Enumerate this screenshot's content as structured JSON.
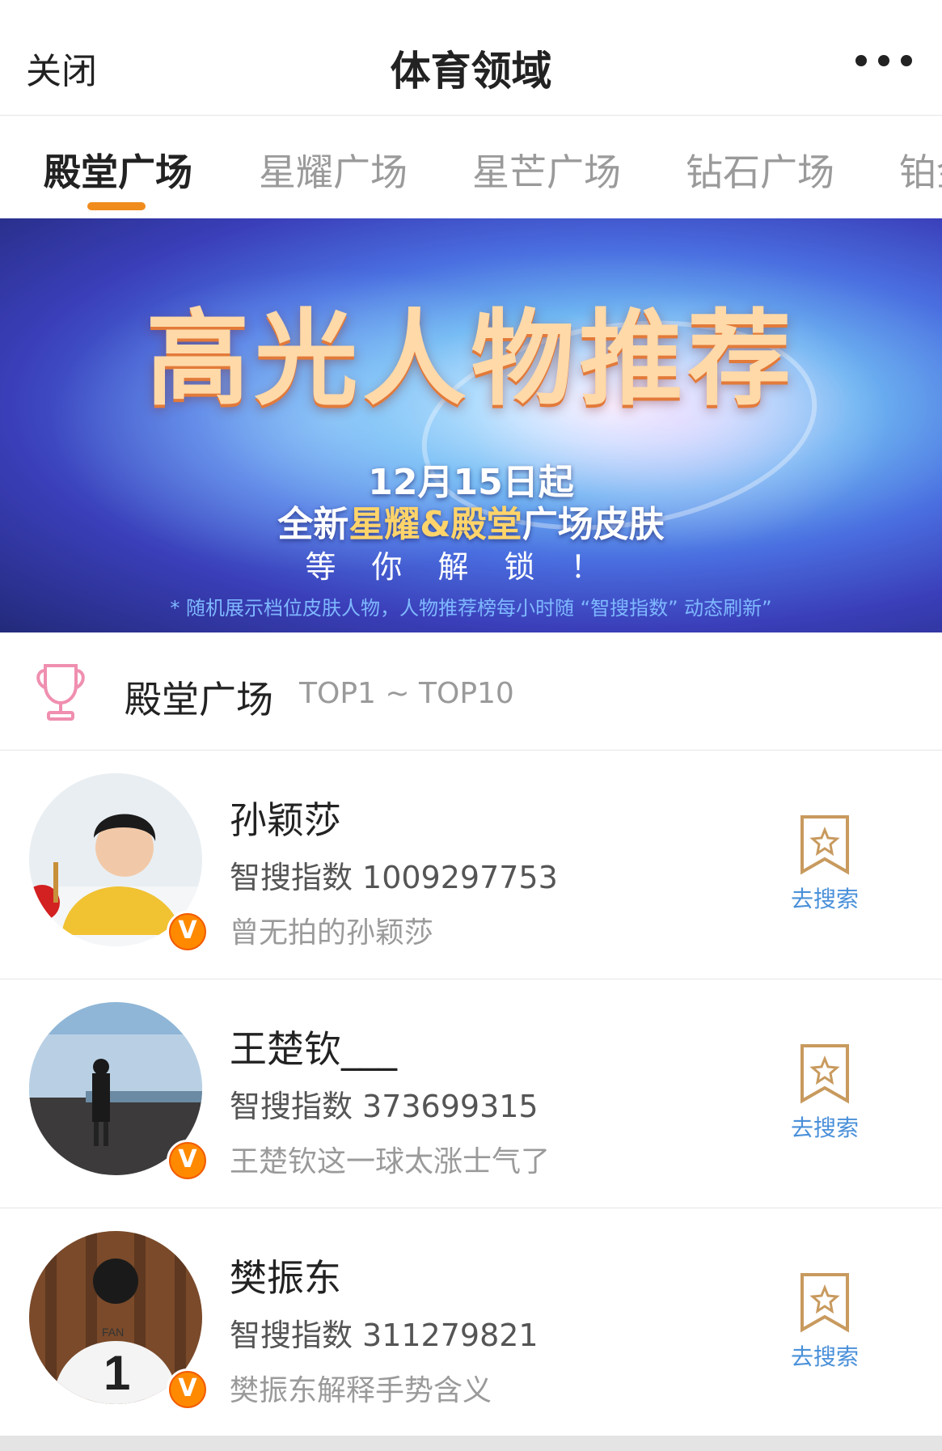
{
  "header": {
    "close_label": "关闭",
    "title": "体育领域",
    "more_icon": "more-dots-icon"
  },
  "tabs": [
    {
      "label": "殿堂广场",
      "active": true
    },
    {
      "label": "星耀广场",
      "active": false
    },
    {
      "label": "星芒广场",
      "active": false
    },
    {
      "label": "钻石广场",
      "active": false
    },
    {
      "label": "铂金",
      "active": false
    }
  ],
  "banner": {
    "headline": "高光人物推荐",
    "date": "12月15日起",
    "subtitle_part1": "全新",
    "subtitle_highlight": "星耀&殿堂",
    "subtitle_part2": "广场皮肤",
    "wait": "等你解锁！",
    "note": "* 随机展示档位皮肤人物，人物推荐榜每小时随 “智搜指数” 动态刷新”"
  },
  "section": {
    "icon": "trophy-icon",
    "title": "殿堂广场",
    "range": "TOP1 ~ TOP10"
  },
  "list": [
    {
      "name": "孙颖莎",
      "index_label": "智搜指数",
      "index_value": "1009297753",
      "desc": "曾无拍的孙颖莎",
      "search_label": "去搜索"
    },
    {
      "name": "王楚钦___",
      "index_label": "智搜指数",
      "index_value": "373699315",
      "desc": "王楚钦这一球太涨士气了",
      "search_label": "去搜索"
    },
    {
      "name": "樊振东",
      "index_label": "智搜指数",
      "index_value": "311279821",
      "desc": "樊振东解释手势含义",
      "search_label": "去搜索"
    }
  ],
  "colors": {
    "accent": "#f08c1d",
    "link": "#4a90d9",
    "verified": "#ff8a00"
  }
}
